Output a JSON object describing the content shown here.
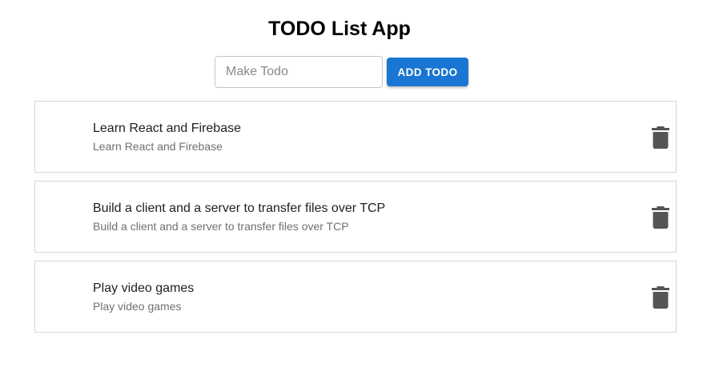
{
  "app": {
    "title": "TODO List App"
  },
  "form": {
    "input_placeholder": "Make Todo",
    "input_value": "",
    "add_button_label": "ADD TODO"
  },
  "todos": [
    {
      "primary": "Learn React and Firebase",
      "secondary": "Learn React and Firebase",
      "action_icon": "trash-icon"
    },
    {
      "primary": "Build a client and a server to transfer files over TCP",
      "secondary": "Build a client and a server to transfer files over TCP",
      "action_icon": "trash-icon"
    },
    {
      "primary": "Play video games",
      "secondary": "Play video games",
      "action_icon": "trash-icon"
    }
  ],
  "colors": {
    "accent": "#1976d2",
    "icon": "#555555",
    "border": "#d6d6d6"
  }
}
